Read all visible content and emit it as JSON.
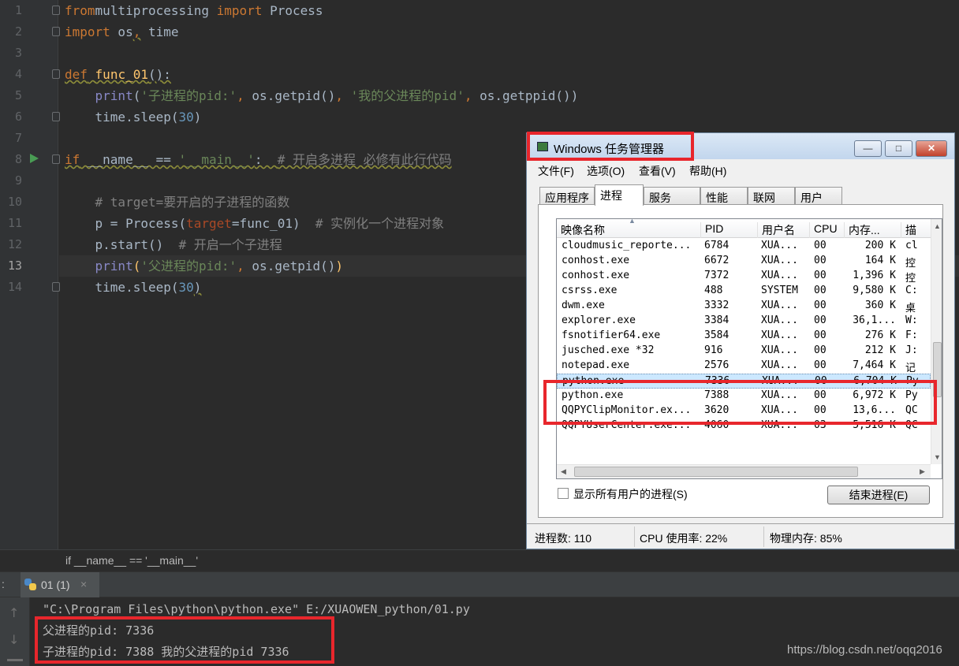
{
  "editor": {
    "line_numbers": [
      "1",
      "2",
      "3",
      "4",
      "5",
      "6",
      "7",
      "8",
      "9",
      "10",
      "11",
      "12",
      "13",
      "14"
    ],
    "lines": [
      [
        [
          "kw",
          "from"
        ],
        [
          "",
          "multiprocessing "
        ],
        [
          "kw",
          "import"
        ],
        [
          "",
          " Process"
        ]
      ],
      [
        [
          "kw",
          "import"
        ],
        [
          "",
          " os"
        ],
        [
          "kw wavy",
          ","
        ],
        [
          "",
          " time"
        ]
      ],
      [],
      [
        [
          "kw wavy",
          "def"
        ],
        [
          "wavy",
          " "
        ],
        [
          "fn wavy",
          "func_01"
        ],
        [
          "wavy",
          "():"
        ]
      ],
      [
        [
          "",
          "    "
        ],
        [
          "bi",
          "print"
        ],
        [
          "",
          "("
        ],
        [
          "st",
          "'子进程的pid:'"
        ],
        [
          "kw",
          ", "
        ],
        [
          "",
          "os.getpid()"
        ],
        [
          "kw",
          ", "
        ],
        [
          "st",
          "'我的父进程的pid'"
        ],
        [
          "kw",
          ", "
        ],
        [
          "",
          "os.getppid())"
        ]
      ],
      [
        [
          "",
          "    time.sleep("
        ],
        [
          "nm",
          "30"
        ],
        [
          "",
          ")"
        ]
      ],
      [],
      [
        [
          "kw wavy",
          "if"
        ],
        [
          "wavy",
          " __name__ == "
        ],
        [
          "st wavy",
          "'__main__'"
        ],
        [
          "wavy",
          ":  "
        ],
        [
          "cm wavy",
          "# 开启多进程 必修有此行代码"
        ]
      ],
      [],
      [
        [
          "",
          "    "
        ],
        [
          "cm",
          "# target=要开启的子进程的函数"
        ]
      ],
      [
        [
          "",
          "    p = Process("
        ],
        [
          "pa",
          "target"
        ],
        [
          "",
          "=func_01)  "
        ],
        [
          "cm",
          "# 实例化一个进程对象"
        ]
      ],
      [
        [
          "",
          "    p.start()  "
        ],
        [
          "cm",
          "# 开启一个子进程"
        ]
      ],
      [
        [
          "",
          "    "
        ],
        [
          "bi",
          "print"
        ],
        [
          "fn",
          "("
        ],
        [
          "st",
          "'父进程的pid:'"
        ],
        [
          "kw",
          ", "
        ],
        [
          "",
          "os.getpid()"
        ],
        [
          "fn",
          ")"
        ]
      ],
      [
        [
          "",
          "    time.sleep("
        ],
        [
          "nm",
          "30"
        ],
        [
          "wavy",
          ")"
        ]
      ]
    ]
  },
  "breadcrumb": "if __name__ == '__main__'",
  "run_panel": {
    "tab_label": "01 (1)",
    "tab_close": "×",
    "prefix": ":"
  },
  "console": {
    "lines": [
      "\"C:\\Program Files\\python\\python.exe\" E:/XUAOWEN_python/01.py",
      "父进程的pid: 7336",
      "子进程的pid: 7388 我的父进程的pid 7336"
    ]
  },
  "watermark": "https://blog.csdn.net/oqq2016",
  "task_manager": {
    "title": "Windows 任务管理器",
    "window_buttons": {
      "minimize": "—",
      "maximize": "□",
      "close": "✕"
    },
    "menu": [
      "文件(F)",
      "选项(O)",
      "查看(V)",
      "帮助(H)"
    ],
    "tabs": [
      "应用程序",
      "进程",
      "服务",
      "性能",
      "联网",
      "用户"
    ],
    "active_tab": "进程",
    "columns": [
      "映像名称",
      "PID",
      "用户名",
      "CPU",
      "内存...",
      "描"
    ],
    "rows": [
      [
        "cloudmusic_reporte...",
        "6784",
        "XUA...",
        "00",
        "200 K",
        "cl"
      ],
      [
        "conhost.exe",
        "6672",
        "XUA...",
        "00",
        "164 K",
        "控"
      ],
      [
        "conhost.exe",
        "7372",
        "XUA...",
        "00",
        "1,396 K",
        "控"
      ],
      [
        "csrss.exe",
        "488",
        "SYSTEM",
        "00",
        "9,580 K",
        "C:"
      ],
      [
        "dwm.exe",
        "3332",
        "XUA...",
        "00",
        "360 K",
        "桌"
      ],
      [
        "explorer.exe",
        "3384",
        "XUA...",
        "00",
        "36,1...",
        "W:"
      ],
      [
        "fsnotifier64.exe",
        "3584",
        "XUA...",
        "00",
        "276 K",
        "F:"
      ],
      [
        "jusched.exe *32",
        "916",
        "XUA...",
        "00",
        "212 K",
        "J:"
      ],
      [
        "notepad.exe",
        "2576",
        "XUA...",
        "00",
        "7,464 K",
        "记"
      ],
      [
        "python.exe",
        "7336",
        "XUA...",
        "00",
        "6,704 K",
        "Py"
      ],
      [
        "python.exe",
        "7388",
        "XUA...",
        "00",
        "6,972 K",
        "Py"
      ],
      [
        "QQPYClipMonitor.ex...",
        "3620",
        "XUA...",
        "00",
        "13,6...",
        "QC"
      ],
      [
        "QQPYUserCenter.exe...",
        "4060",
        "XUA...",
        "03",
        "5,516 K",
        "QC"
      ]
    ],
    "selected_row": 9,
    "show_all_label": "显示所有用户的进程(S)",
    "end_process_label": "结束进程(E)",
    "status": [
      "进程数: 110",
      "CPU 使用率: 22%",
      "物理内存: 85%"
    ]
  },
  "colors": {
    "editor_bg": "#2b2b2b",
    "keyword": "#cc7832",
    "string": "#6a8759",
    "highlight_box": "#e8262c",
    "selection": "#cce8ff"
  }
}
